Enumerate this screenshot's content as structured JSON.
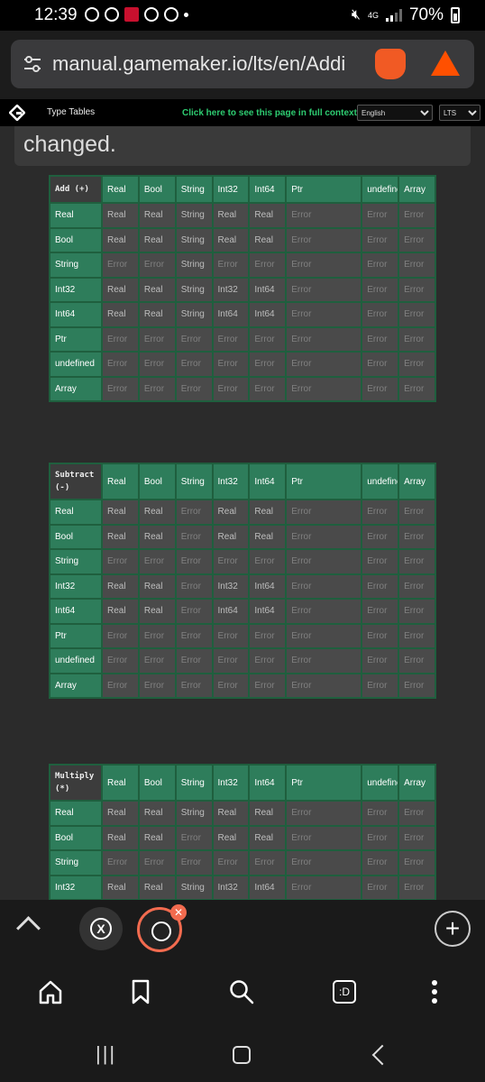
{
  "status_bar": {
    "time": "12:39",
    "network": "4G",
    "battery": "70%"
  },
  "browser": {
    "url": "manual.gamemaker.io/lts/en/Addi",
    "accent": "#f26b4f"
  },
  "header": {
    "title": "Type Tables",
    "full_context_link": "Click here to see this page in full context",
    "language": "English",
    "version": "LTS"
  },
  "notice": {
    "text": "changed."
  },
  "columns": [
    "Real",
    "Bool",
    "String",
    "Int32",
    "Int64",
    "Ptr",
    "undefined",
    "Array"
  ],
  "tables": [
    {
      "corner": "Add (+)",
      "rows": [
        {
          "label": "Real",
          "cells": [
            "Real",
            "Real",
            "String",
            "Real",
            "Real",
            "Error",
            "Error",
            "Error"
          ]
        },
        {
          "label": "Bool",
          "cells": [
            "Real",
            "Real",
            "String",
            "Real",
            "Real",
            "Error",
            "Error",
            "Error"
          ]
        },
        {
          "label": "String",
          "cells": [
            "Error",
            "Error",
            "String",
            "Error",
            "Error",
            "Error",
            "Error",
            "Error"
          ]
        },
        {
          "label": "Int32",
          "cells": [
            "Real",
            "Real",
            "String",
            "Int32",
            "Int64",
            "Error",
            "Error",
            "Error"
          ]
        },
        {
          "label": "Int64",
          "cells": [
            "Real",
            "Real",
            "String",
            "Int64",
            "Int64",
            "Error",
            "Error",
            "Error"
          ]
        },
        {
          "label": "Ptr",
          "cells": [
            "Error",
            "Error",
            "Error",
            "Error",
            "Error",
            "Error",
            "Error",
            "Error"
          ]
        },
        {
          "label": "undefined",
          "cells": [
            "Error",
            "Error",
            "Error",
            "Error",
            "Error",
            "Error",
            "Error",
            "Error"
          ]
        },
        {
          "label": "Array",
          "cells": [
            "Error",
            "Error",
            "Error",
            "Error",
            "Error",
            "Error",
            "Error",
            "Error"
          ]
        }
      ]
    },
    {
      "corner": "Subtract (-)",
      "rows": [
        {
          "label": "Real",
          "cells": [
            "Real",
            "Real",
            "Error",
            "Real",
            "Real",
            "Error",
            "Error",
            "Error"
          ]
        },
        {
          "label": "Bool",
          "cells": [
            "Real",
            "Real",
            "Error",
            "Real",
            "Real",
            "Error",
            "Error",
            "Error"
          ]
        },
        {
          "label": "String",
          "cells": [
            "Error",
            "Error",
            "Error",
            "Error",
            "Error",
            "Error",
            "Error",
            "Error"
          ]
        },
        {
          "label": "Int32",
          "cells": [
            "Real",
            "Real",
            "Error",
            "Int32",
            "Int64",
            "Error",
            "Error",
            "Error"
          ]
        },
        {
          "label": "Int64",
          "cells": [
            "Real",
            "Real",
            "Error",
            "Int64",
            "Int64",
            "Error",
            "Error",
            "Error"
          ]
        },
        {
          "label": "Ptr",
          "cells": [
            "Error",
            "Error",
            "Error",
            "Error",
            "Error",
            "Error",
            "Error",
            "Error"
          ]
        },
        {
          "label": "undefined",
          "cells": [
            "Error",
            "Error",
            "Error",
            "Error",
            "Error",
            "Error",
            "Error",
            "Error"
          ]
        },
        {
          "label": "Array",
          "cells": [
            "Error",
            "Error",
            "Error",
            "Error",
            "Error",
            "Error",
            "Error",
            "Error"
          ]
        }
      ]
    },
    {
      "corner": "Multiply (*)",
      "rows": [
        {
          "label": "Real",
          "cells": [
            "Real",
            "Real",
            "String",
            "Real",
            "Real",
            "Error",
            "Error",
            "Error"
          ]
        },
        {
          "label": "Bool",
          "cells": [
            "Real",
            "Real",
            "Error",
            "Real",
            "Real",
            "Error",
            "Error",
            "Error"
          ]
        },
        {
          "label": "String",
          "cells": [
            "Error",
            "Error",
            "Error",
            "Error",
            "Error",
            "Error",
            "Error",
            "Error"
          ]
        },
        {
          "label": "Int32",
          "cells": [
            "Real",
            "Real",
            "String",
            "Int32",
            "Int64",
            "Error",
            "Error",
            "Error"
          ]
        }
      ]
    }
  ],
  "bottom_bar": {
    "tabs_label": ":D"
  }
}
